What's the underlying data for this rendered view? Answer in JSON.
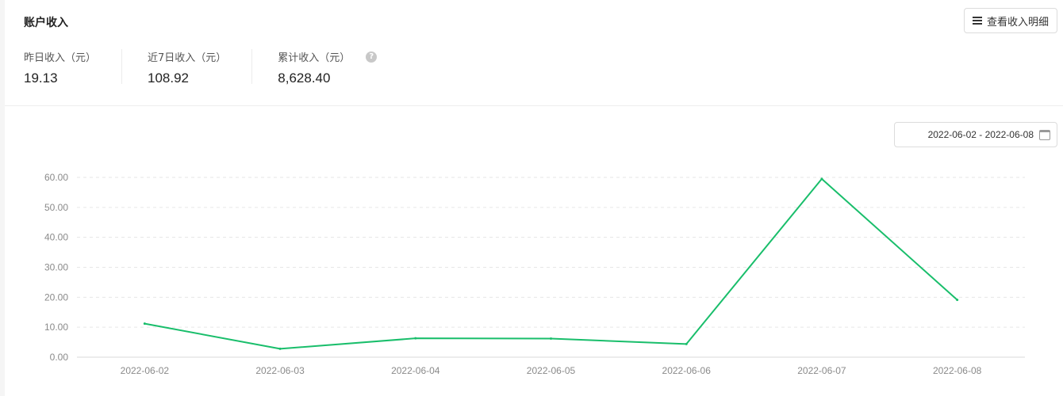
{
  "header": {
    "title": "账户收入",
    "detail_button_label": "查看收入明细"
  },
  "stats": [
    {
      "label": "昨日收入（元）",
      "value": "19.13"
    },
    {
      "label": "近7日收入（元）",
      "value": "108.92"
    },
    {
      "label": "累计收入（元）",
      "value": "8,628.40"
    }
  ],
  "date_range": "2022-06-02 - 2022-06-08",
  "icons": {
    "menu": "menu-icon",
    "help": "help-icon",
    "calendar": "calendar-icon"
  },
  "colors": {
    "line": "#19be6b"
  },
  "chart_data": {
    "type": "line",
    "x": [
      "2022-06-02",
      "2022-06-03",
      "2022-06-04",
      "2022-06-05",
      "2022-06-06",
      "2022-06-07",
      "2022-06-08"
    ],
    "series": [
      {
        "values": [
          11.2,
          2.8,
          6.3,
          6.2,
          4.4,
          59.5,
          19.13
        ]
      }
    ],
    "yticks": [
      "0.00",
      "10.00",
      "20.00",
      "30.00",
      "40.00",
      "50.00",
      "60.00"
    ],
    "ylim": [
      0,
      60
    ],
    "grid": true
  }
}
